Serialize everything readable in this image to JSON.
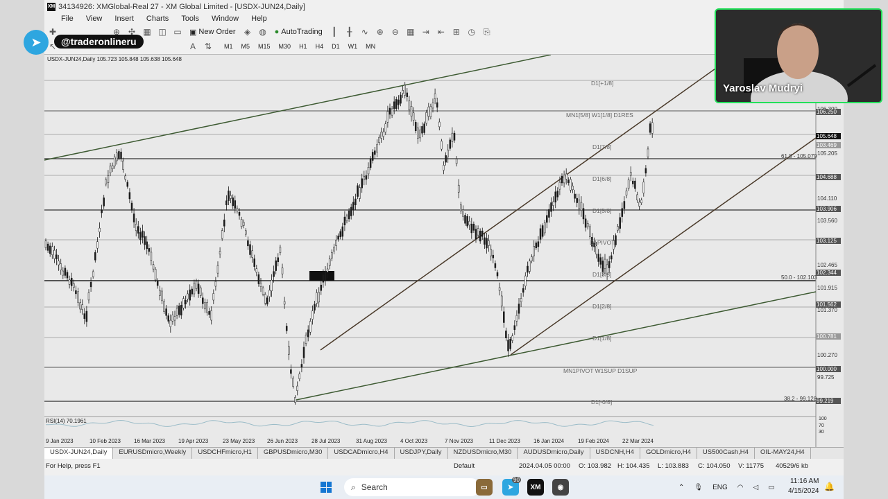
{
  "window": {
    "title": "34134926: XMGlobal-Real 27 - XM Global Limited - [USDX-JUN24,Daily]",
    "logo_text": "XM"
  },
  "menu": [
    "File",
    "View",
    "Insert",
    "Charts",
    "Tools",
    "Window",
    "Help"
  ],
  "toolbar": {
    "new_order": "New Order",
    "autotrading": "AutoTrading"
  },
  "timeframes": [
    "M1",
    "M5",
    "M15",
    "M30",
    "H1",
    "H4",
    "D1",
    "W1",
    "MN"
  ],
  "overlay": {
    "telegram_handle": "@traderonlineru",
    "streamer_name": "Yaroslav Mudryi"
  },
  "chart": {
    "ohlc_text": "USDX-JUN24,Daily  105.723 105.848 105.638 105.648",
    "level_labels": [
      "D1[+1/8]",
      "MN1[5/8] W1[1/8] D1RES",
      "D1[7/8]",
      "D1[6/8]",
      "D1[5/8]",
      "D1PIVOT",
      "D1[3/8]",
      "D1[2/8]",
      "D1[1/8]",
      "MN1PIVOT W1SUP D1SUP",
      "D1[-0/8]"
    ],
    "fib_labels": [
      "61.8 - 105.079",
      "50.0 - 102.103",
      "38.2 - 99.128"
    ],
    "price_axis": [
      "106.300",
      "105.205",
      "104.110",
      "103.560",
      "102.465",
      "101.915",
      "101.370",
      "100.270",
      "99.725"
    ],
    "price_boxes": [
      "106.250",
      "105.648",
      "103.469",
      "104.688",
      "103.906",
      "103.125",
      "102.344",
      "101.562",
      "100.781",
      "100.000",
      "99.219"
    ],
    "date_axis": [
      "9 Jan 2023",
      "10 Feb 2023",
      "16 Mar 2023",
      "19 Apr 2023",
      "23 May 2023",
      "26 Jun 2023",
      "28 Jul 2023",
      "31 Aug 2023",
      "4 Oct 2023",
      "7 Nov 2023",
      "11 Dec 2023",
      "16 Jan 2024",
      "19 Feb 2024",
      "22 Mar 2024"
    ],
    "rsi_label": "RSI(14) 70.1961",
    "rsi_ticks": [
      "100",
      "70",
      "30"
    ]
  },
  "tabs": [
    "USDX-JUN24,Daily",
    "EURUSDmicro,Weekly",
    "USDCHFmicro,H1",
    "GBPUSDmicro,M30",
    "USDCADmicro,H4",
    "USDJPY,Daily",
    "NZDUSDmicro,M30",
    "AUDUSDmicro,Daily",
    "USDCNH,H4",
    "GOLDmicro,H4",
    "US500Cash,H4",
    "OIL-MAY24,H4"
  ],
  "status": {
    "help": "For Help, press F1",
    "profile": "Default",
    "datetime": "2024.04.05 00:00",
    "open": "O: 103.982",
    "high": "H: 104.435",
    "low": "L: 103.883",
    "close": "C: 104.050",
    "volume": "V: 11775",
    "traffic": "40529/6 kb"
  },
  "taskbar": {
    "search_placeholder": "Search",
    "badge_count": "90",
    "lang": "ENG",
    "time": "11:16 AM",
    "date": "4/15/2024"
  },
  "colors": {
    "chart_bg": "#e9e9e9",
    "candle": "#1a1a1a",
    "trendline": "#4a3a2a",
    "green_line": "#3d5a32",
    "webcam_border": "#23e05a",
    "telegram": "#2ea6e0"
  }
}
